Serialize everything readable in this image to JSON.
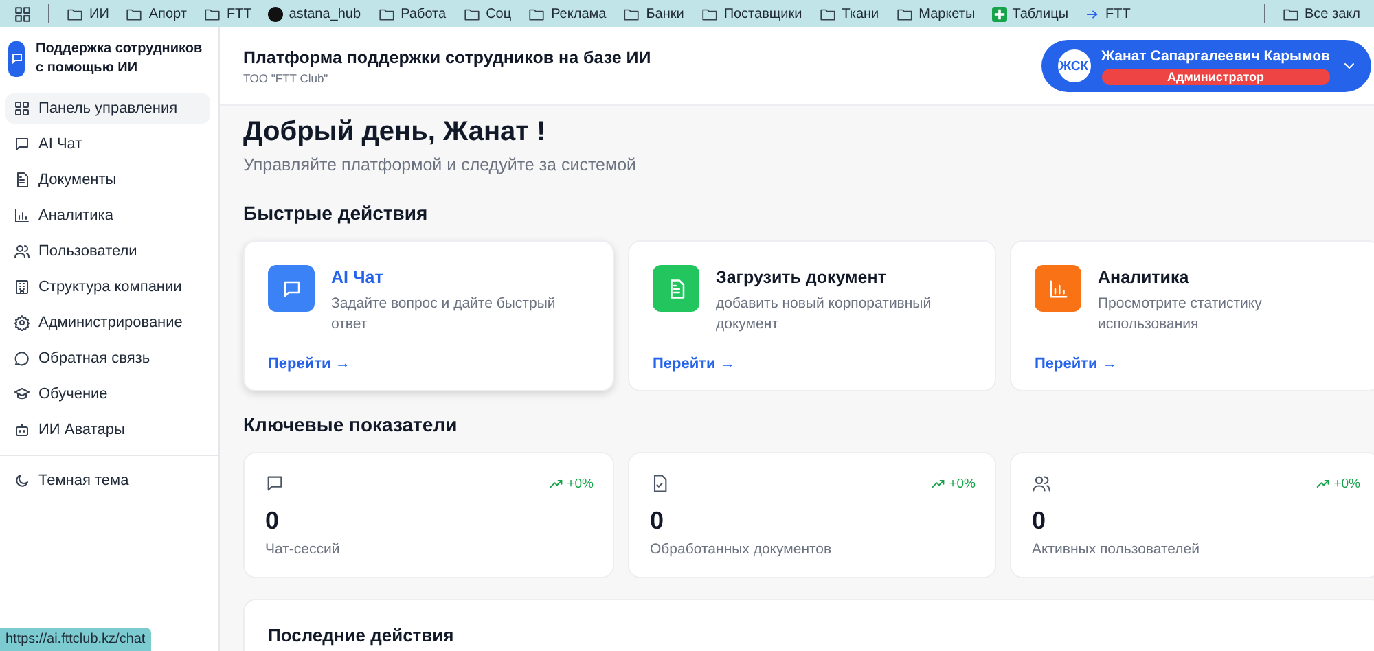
{
  "bookmarks_bar": {
    "items": [
      {
        "kind": "folder",
        "label": "ИИ"
      },
      {
        "kind": "folder",
        "label": "Апорт"
      },
      {
        "kind": "folder",
        "label": "FTT"
      },
      {
        "kind": "site",
        "label": "astana_hub"
      },
      {
        "kind": "folder",
        "label": "Работа"
      },
      {
        "kind": "folder",
        "label": "Соц"
      },
      {
        "kind": "folder",
        "label": "Реклама"
      },
      {
        "kind": "folder",
        "label": "Банки"
      },
      {
        "kind": "folder",
        "label": "Поставщики"
      },
      {
        "kind": "folder",
        "label": "Ткани"
      },
      {
        "kind": "folder",
        "label": "Маркеты"
      },
      {
        "kind": "sheets",
        "label": "Таблицы"
      },
      {
        "kind": "link",
        "label": "FTT"
      }
    ],
    "all_bookmarks": "Все закл"
  },
  "sidebar": {
    "brand": "Поддержка сотрудников с помощью ИИ",
    "items": [
      {
        "label": "Панель управления",
        "selected": true
      },
      {
        "label": "AI Чат",
        "selected": false
      },
      {
        "label": "Документы",
        "selected": false
      },
      {
        "label": "Аналитика",
        "selected": false
      },
      {
        "label": "Пользователи",
        "selected": false
      },
      {
        "label": "Структура компании",
        "selected": false
      },
      {
        "label": "Администрирование",
        "selected": false
      },
      {
        "label": "Обратная связь",
        "selected": false
      },
      {
        "label": "Обучение",
        "selected": false
      },
      {
        "label": "ИИ Аватары",
        "selected": false
      }
    ],
    "theme_toggle": "Темная тема"
  },
  "header": {
    "title": "Платформа поддержки сотрудников на базе ИИ",
    "subtitle": "ТОО \"FTT Club\"",
    "user": {
      "initials": "ЖСК",
      "name": "Жанат Сапаргалеевич Карымов",
      "role": "Администратор"
    }
  },
  "greeting": {
    "title": "Добрый день, Жанат !",
    "subtitle": "Управляйте платформой и следуйте за системой"
  },
  "quick_actions": {
    "title": "Быстрые действия",
    "cards": [
      {
        "color": "#3b82f6",
        "title": "AI Чат",
        "description": "Задайте вопрос и дайте быстрый ответ",
        "link": "Перейти →",
        "highlighted": true
      },
      {
        "color": "#22c55e",
        "title": "Загрузить документ",
        "description": "добавить новый корпоративный документ",
        "link": "Перейти →",
        "highlighted": false
      },
      {
        "color": "#f97316",
        "title": "Аналитика",
        "description": "Просмотрите статистику использования",
        "link": "Перейти →",
        "highlighted": false
      }
    ]
  },
  "key_metrics": {
    "title": "Ключевые показатели",
    "cards": [
      {
        "trend": "+0%",
        "value": "0",
        "label": "Чат-сессий"
      },
      {
        "trend": "+0%",
        "value": "0",
        "label": "Обработанных документов"
      },
      {
        "trend": "+0%",
        "value": "0",
        "label": "Активных пользователей"
      }
    ]
  },
  "recent_activity": {
    "title": "Последние действия"
  },
  "status_url": "https://ai.fttclub.kz/chat"
}
